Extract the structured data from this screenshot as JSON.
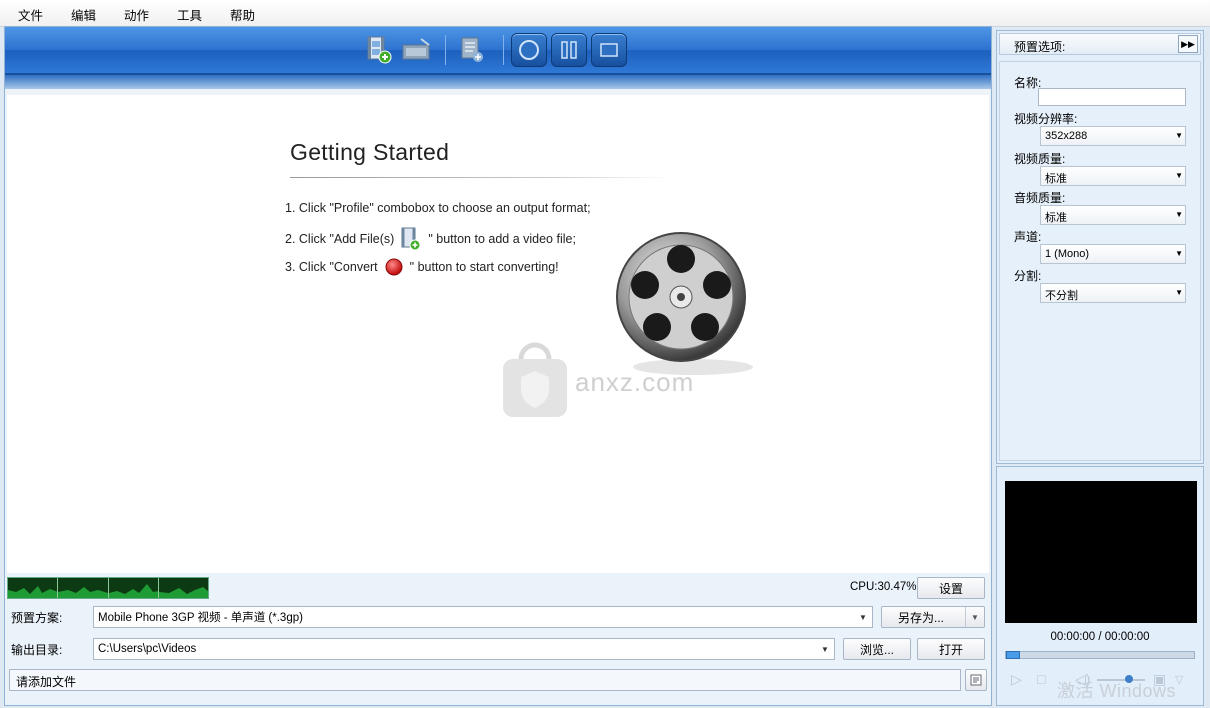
{
  "menubar": {
    "items": [
      "文件",
      "编辑",
      "动作",
      "工具",
      "帮助"
    ]
  },
  "getting_started": {
    "title": "Getting Started",
    "step1": "1. Click \"Profile\" combobox to choose an output format;",
    "step2_before": "2. Click \"Add File(s)",
    "step2_after": "\" button to add a video file;",
    "step3_before": "3. Click \"Convert",
    "step3_after": "\" button to start converting!"
  },
  "watermark": {
    "text": "anxz.com"
  },
  "bottom": {
    "cpu": "CPU:30.47%",
    "settings_button": "设置",
    "preset_label": "预置方案:",
    "preset_value": "Mobile Phone 3GP 视频 - 单声道 (*.3gp)",
    "save_as_button": "另存为...",
    "output_label": "输出目录:",
    "output_value": "C:\\Users\\pc\\Videos",
    "browse_button": "浏览...",
    "open_button": "打开",
    "status": "请添加文件"
  },
  "props": {
    "title": "预置选项:",
    "name_label": "名称:",
    "name_value": "",
    "resolution_label": "视频分辨率:",
    "resolution_value": "352x288",
    "video_quality_label": "视频质量:",
    "video_quality_value": "标准",
    "audio_quality_label": "音频质量:",
    "audio_quality_value": "标准",
    "channel_label": "声道:",
    "channel_value": "1 (Mono)",
    "split_label": "分割:",
    "split_value": "不分割"
  },
  "preview": {
    "time": "00:00:00 / 00:00:00",
    "os_watermark": "激活 Windows"
  },
  "colors": {
    "toolbar_blue": "#2d72cf",
    "convert_red": "#d81c1c",
    "cpu_graph": "#1f9b35"
  }
}
